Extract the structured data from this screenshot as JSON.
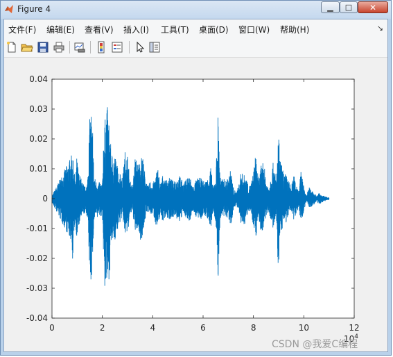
{
  "window": {
    "title": "Figure 4",
    "controls": {
      "minimize": "▁",
      "maximize": "□",
      "close": "✕"
    }
  },
  "menubar": {
    "items": [
      {
        "label": "文件(F)",
        "icon": "none"
      },
      {
        "label": "编辑(E)",
        "icon": "none"
      },
      {
        "label": "查看(V)",
        "icon": "none"
      },
      {
        "label": "插入(I)",
        "icon": "none"
      },
      {
        "label": "工具(T)",
        "icon": "none"
      },
      {
        "label": "桌面(D)",
        "icon": "none"
      },
      {
        "label": "窗口(W)",
        "icon": "none"
      },
      {
        "label": "帮助(H)",
        "icon": "none"
      }
    ],
    "overflow_icon": "dock-arrow-icon"
  },
  "toolbar": {
    "buttons": [
      "new-figure-icon",
      "open-file-icon",
      "save-icon",
      "print-icon",
      "link-plot-icon",
      "insert-colorbar-icon",
      "insert-legend-icon",
      "pointer-icon",
      "property-inspector-icon"
    ]
  },
  "chart_data": {
    "type": "line",
    "title": "",
    "xlabel": "",
    "ylabel": "",
    "xlim": [
      0,
      12
    ],
    "ylim": [
      -0.04,
      0.04
    ],
    "x_ticks": [
      "0",
      "2",
      "4",
      "6",
      "8",
      "10",
      "12"
    ],
    "y_ticks": [
      "0.04",
      "0.03",
      "0.02",
      "0.01",
      "0",
      "-0.01",
      "-0.02",
      "-0.03",
      "-0.04"
    ],
    "x_exponent_label": "10^4",
    "grid": false,
    "line_color": "#0072bd",
    "series": [
      {
        "x": [
          0,
          0.8,
          0.82,
          0.86,
          0.9,
          0.94,
          0.98,
          1.02,
          1.06,
          1.1,
          1.2,
          1.3,
          1.4,
          1.5,
          1.55,
          1.6,
          1.62,
          1.66,
          1.7,
          1.75,
          1.8,
          1.85,
          1.9,
          1.95,
          2.0,
          2.05,
          2.1,
          2.15,
          2.2,
          2.25,
          2.3,
          2.35,
          2.4,
          2.5,
          2.6,
          2.7,
          2.8,
          2.9,
          3.0,
          3.1,
          3.2,
          3.3,
          3.4,
          3.5,
          3.6,
          3.7,
          3.8,
          3.9,
          4.0,
          4.1,
          4.2,
          4.3,
          4.4,
          4.5,
          4.6,
          4.7,
          4.8,
          4.9,
          5.0,
          5.1,
          5.2,
          5.3,
          5.4,
          5.5,
          5.6,
          5.7,
          5.8,
          5.9,
          6.0,
          6.1,
          6.2,
          6.3,
          6.4,
          6.5,
          6.55,
          6.6,
          6.65,
          6.7,
          6.8,
          6.9,
          7.0,
          7.1,
          7.2,
          7.3,
          7.4,
          7.5,
          7.6,
          7.7,
          7.8,
          7.9,
          8.0,
          8.1,
          8.2,
          8.3,
          8.4,
          8.5,
          8.6,
          8.7,
          8.8,
          8.9,
          9.0,
          9.05,
          9.1,
          9.2,
          9.3,
          9.4,
          9.5,
          9.6,
          9.7,
          9.8,
          9.9,
          10.0,
          10.1,
          10.2,
          10.3,
          10.4,
          10.5,
          10.6,
          10.7,
          10.8,
          10.9,
          11.0
        ],
        "upper": [
          0.001,
          0.015,
          0.016,
          0.011,
          0.008,
          0.006,
          0.014,
          0.012,
          0.009,
          0.008,
          0.006,
          0.004,
          0.005,
          0.027,
          0.031,
          0.022,
          0.027,
          0.009,
          0.007,
          0.006,
          0.006,
          0.005,
          0.006,
          0.005,
          0.005,
          0.022,
          0.026,
          0.03,
          0.031,
          0.027,
          0.022,
          0.016,
          0.015,
          0.015,
          0.011,
          0.009,
          0.007,
          0.016,
          0.015,
          0.006,
          0.004,
          0.014,
          0.012,
          0.013,
          0.015,
          0.008,
          0.004,
          0.006,
          0.005,
          0.007,
          0.011,
          0.005,
          0.008,
          0.006,
          0.007,
          0.007,
          0.006,
          0.007,
          0.007,
          0.008,
          0.005,
          0.006,
          0.008,
          0.007,
          0.004,
          0.006,
          0.007,
          0.007,
          0.006,
          0.006,
          0.007,
          0.011,
          0.004,
          0.007,
          0.018,
          0.03,
          0.014,
          0.006,
          0.007,
          0.006,
          0.007,
          0.01,
          0.004,
          0.002,
          0.004,
          0.009,
          0.008,
          0.008,
          0.004,
          0.005,
          0.009,
          0.016,
          0.006,
          0.011,
          0.013,
          0.006,
          0.004,
          0.008,
          0.013,
          0.006,
          0.022,
          0.014,
          0.012,
          0.009,
          0.008,
          0.006,
          0.004,
          0.008,
          0.005,
          0.003,
          0.01,
          0.004,
          0.001,
          0.004,
          0.003,
          0.002,
          0.001,
          0.002,
          0.001,
          0.001,
          0.0006,
          0.0004
        ],
        "lower": [
          -0.0015,
          -0.015,
          -0.03,
          -0.012,
          -0.01,
          -0.008,
          -0.015,
          -0.012,
          -0.01,
          -0.008,
          -0.006,
          -0.005,
          -0.006,
          -0.025,
          -0.03,
          -0.022,
          -0.02,
          -0.009,
          -0.007,
          -0.006,
          -0.007,
          -0.005,
          -0.006,
          -0.006,
          -0.005,
          -0.022,
          -0.031,
          -0.03,
          -0.031,
          -0.028,
          -0.024,
          -0.016,
          -0.015,
          -0.014,
          -0.011,
          -0.008,
          -0.006,
          -0.013,
          -0.012,
          -0.006,
          -0.004,
          -0.012,
          -0.01,
          -0.014,
          -0.013,
          -0.007,
          -0.004,
          -0.006,
          -0.005,
          -0.008,
          -0.011,
          -0.005,
          -0.008,
          -0.006,
          -0.007,
          -0.007,
          -0.006,
          -0.007,
          -0.007,
          -0.008,
          -0.005,
          -0.006,
          -0.008,
          -0.007,
          -0.004,
          -0.006,
          -0.007,
          -0.007,
          -0.006,
          -0.006,
          -0.007,
          -0.011,
          -0.004,
          -0.008,
          -0.018,
          -0.029,
          -0.013,
          -0.006,
          -0.007,
          -0.006,
          -0.007,
          -0.01,
          -0.004,
          -0.002,
          -0.004,
          -0.009,
          -0.009,
          -0.008,
          -0.004,
          -0.005,
          -0.009,
          -0.013,
          -0.006,
          -0.012,
          -0.011,
          -0.006,
          -0.004,
          -0.008,
          -0.011,
          -0.006,
          -0.028,
          -0.012,
          -0.011,
          -0.009,
          -0.008,
          -0.006,
          -0.004,
          -0.007,
          -0.005,
          -0.003,
          -0.009,
          -0.004,
          -0.001,
          -0.003,
          -0.003,
          -0.002,
          -0.001,
          -0.002,
          -0.0015,
          -0.001,
          -0.0006,
          -0.0004
        ]
      }
    ]
  },
  "watermark": "CSDN @我爱C编程"
}
